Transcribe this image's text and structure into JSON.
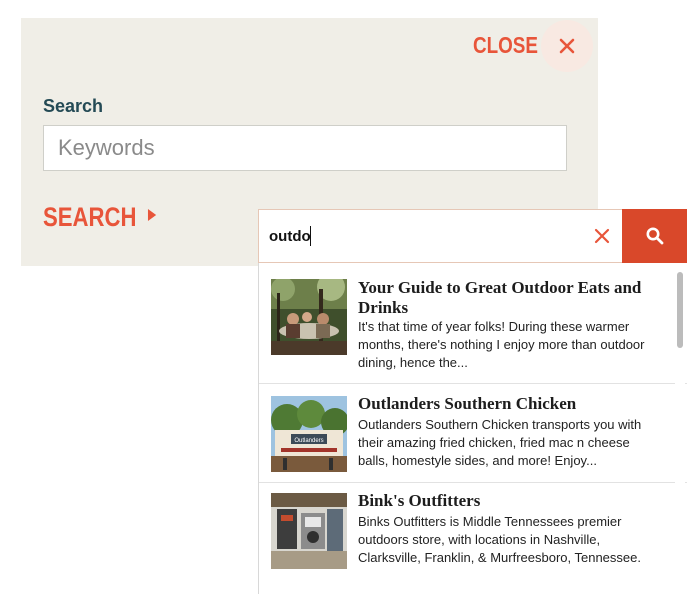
{
  "panel": {
    "close_label": "CLOSE",
    "search_heading": "Search",
    "keywords_placeholder": "Keywords",
    "search_link_label": "SEARCH"
  },
  "autocomplete": {
    "query": "outdo",
    "results": [
      {
        "title": "Your Guide to Great Outdoor Eats and Drinks",
        "description": "It's that time of year folks! During these warmer months, there's nothing I enjoy more than outdoor dining, hence the..."
      },
      {
        "title": "Outlanders Southern Chicken",
        "description": "Outlanders Southern Chicken transports you with their amazing fried chicken, fried mac n cheese balls, homestyle sides, and more! Enjoy...",
        "sign_text": "Outlanders"
      },
      {
        "title": "Bink's Outfitters",
        "description": "Binks Outfitters is Middle Tennessees premier outdoors store, with locations in Nashville, Clarksville, Franklin, & Murfreesboro, Tennessee."
      }
    ]
  },
  "colors": {
    "accent": "#e8553a",
    "search_button": "#d9482a",
    "panel_bg": "#f0eee7",
    "heading": "#244a55"
  },
  "icons": {
    "close": "close-x-icon",
    "clear": "clear-x-icon",
    "search": "magnifier-icon",
    "search_link_arrow": "triangle-right-icon"
  }
}
